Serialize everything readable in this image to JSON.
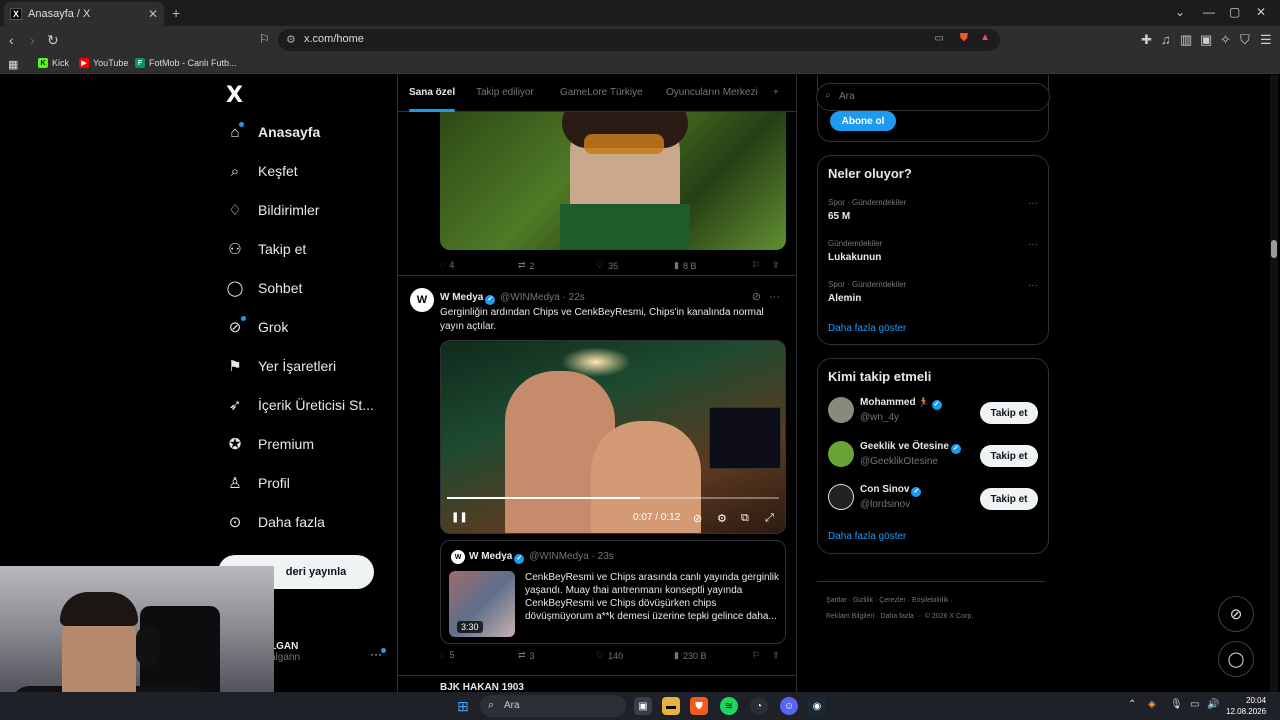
{
  "browser": {
    "tab_title": "Anasayfa / X",
    "url": "x.com/home",
    "bookmarks": [
      {
        "label": "Kick",
        "color": "#53fc18"
      },
      {
        "label": "YouTube",
        "color": "#ff0000"
      },
      {
        "label": "FotMob - Canlı Futb...",
        "color": "#00985f"
      }
    ]
  },
  "nav": {
    "logo": "X",
    "items": [
      {
        "label": "Anasayfa",
        "icon": "home-icon"
      },
      {
        "label": "Keşfet",
        "icon": "search-icon"
      },
      {
        "label": "Bildirimler",
        "icon": "bell-icon"
      },
      {
        "label": "Takip et",
        "icon": "follow-icon"
      },
      {
        "label": "Sohbet",
        "icon": "chat-icon"
      },
      {
        "label": "Grok",
        "icon": "grok-icon"
      },
      {
        "label": "Yer İşaretleri",
        "icon": "bookmark-icon"
      },
      {
        "label": "İçerik Üreticisi St...",
        "icon": "rocket-icon"
      },
      {
        "label": "Premium",
        "icon": "premium-icon"
      },
      {
        "label": "Profil",
        "icon": "profile-icon"
      },
      {
        "label": "Daha fazla",
        "icon": "more-icon"
      }
    ],
    "post_button": "deri yayınla",
    "account_name": "LGAN",
    "account_handle": "algann"
  },
  "feed": {
    "tabs": [
      "Sana özel",
      "Takip ediliyor",
      "GameLore Türkiye",
      "Oyuncuların Merkezi"
    ],
    "add_tab": "+",
    "tweet1_actions": {
      "replies": "4",
      "retweets": "2",
      "likes": "35",
      "views": "8 B"
    },
    "tweet2": {
      "name": "W Medya",
      "handle": "@WINMedya",
      "time": "22s",
      "text": "Gerginliğin ardından Chips ve CenkBeyResmi, Chips'in kanalında normal yayın açtılar.",
      "video_time": "0:07 / 0:12",
      "video_progress": 0.58,
      "quote": {
        "name": "W Medya",
        "handle": "@WINMedya",
        "time": "23s",
        "duration": "3:30",
        "text": "CenkBeyResmi ve Chips arasında canlı yayında gerginlik yaşandı. Muay thai antrenmanı konseptli yayında CenkBeyResmi ve Chips dövüşürken chips dövüşmüyorum a**k demesi üzerine tepki gelince daha..."
      },
      "actions": {
        "replies": "5",
        "retweets": "3",
        "likes": "140",
        "views": "230 B"
      }
    },
    "next_tweet_name": "BJK HAKAN 1903"
  },
  "right": {
    "search_placeholder": "Ara",
    "subscribe_button": "Abone ol",
    "trends_title": "Neler oluyor?",
    "trends": [
      {
        "context": "Spor · Gündemdekiler",
        "topic": "65 M"
      },
      {
        "context": "Gündemdekiler",
        "topic": "Lukakunun"
      },
      {
        "context": "Spor · Gündemdekiler",
        "topic": "Alemin"
      }
    ],
    "show_more": "Daha fazla göster",
    "wtf_title": "Kimi takip etmeli",
    "wtf": [
      {
        "name": "Mohammed",
        "handle": "@wn_4y",
        "avatar_color": "#8a8a7a"
      },
      {
        "name": "Geeklik ve Ötesine",
        "handle": "@GeeklikOtesine",
        "avatar_color": "#6aa334"
      },
      {
        "name": "Con Sinov",
        "handle": "@lordsinov",
        "avatar_color": "#222222"
      }
    ],
    "follow_label": "Takip et",
    "wtf_more": "Daha fazla göster",
    "footer_line1": "Şartlar  ·  Gizlilik  ·  Çerezler  ·  Erişilebilirlik  ·",
    "footer_line2": "Reklam Bilgileri  ·  Daha fazla ···  © 2026 X Corp."
  },
  "taskbar": {
    "search": "Ara",
    "time": "20:04",
    "date": "12.08.2026"
  },
  "colors": {
    "accent": "#1d9bf0",
    "bg": "#000000",
    "border": "#2f3336"
  }
}
